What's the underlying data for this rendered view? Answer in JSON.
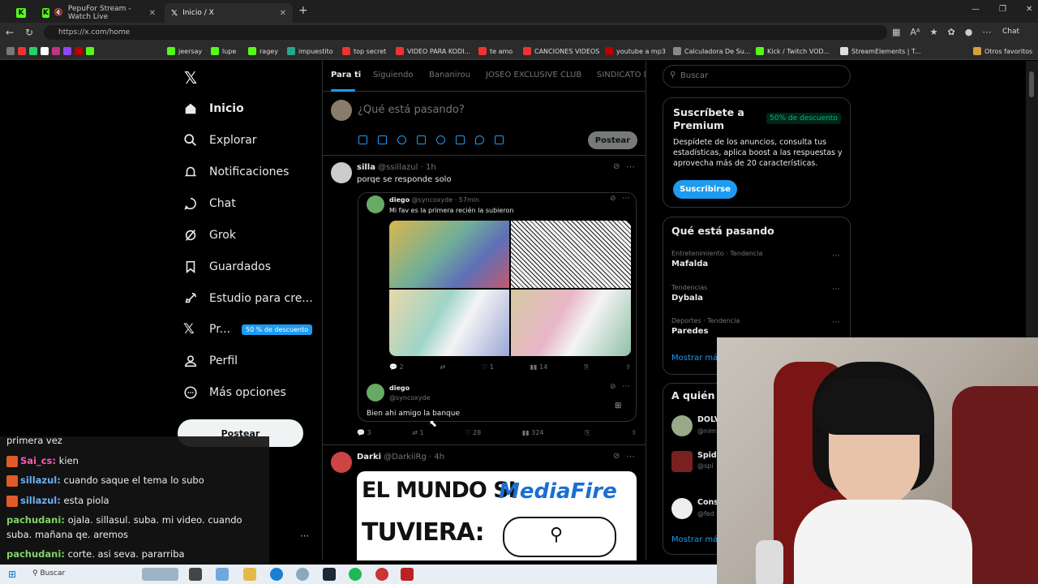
{
  "browser": {
    "tabs": [
      {
        "label": "",
        "icon": "kick-icon"
      },
      {
        "label": "PepuFor Stream - Watch Live",
        "icon": "kick-icon"
      },
      {
        "label": "Inicio / X",
        "icon": "x-icon"
      }
    ],
    "url": "https://x.com/home",
    "chat_label": "Chat",
    "bookmarks": [
      "jeersay",
      "lupe",
      "ragey",
      "impuestito",
      "top secret",
      "VIDEO PARA KODI...",
      "te amo",
      "CANCIONES VIDEOS",
      "youtube a mp3",
      "Calculadora De Su...",
      "Kick / Twitch VOD...",
      "StreamElements | T..."
    ],
    "other_favorites": "Otros favoritos"
  },
  "nav": {
    "items": [
      "Inicio",
      "Explorar",
      "Notificaciones",
      "Chat",
      "Grok",
      "Guardados",
      "Estudio para cre...",
      "Pr...",
      "Perfil",
      "Más opciones"
    ],
    "premium_badge": "50 % de descuento",
    "post_button": "Postear"
  },
  "feed": {
    "tabs": [
      "Para ti",
      "Siguiendo",
      "Bananirou",
      "JOSEO EXCLUSIVE CLUB",
      "SINDICATO D"
    ],
    "composer_placeholder": "¿Qué está pasando?",
    "composer_post": "Postear",
    "tweet1": {
      "name": "silla",
      "handle": "@ssillazul · 1h",
      "text": "porqe se responde solo",
      "quote": {
        "name": "diego",
        "handle": "@syncoxyde · 57min",
        "text": "Mi fav es la primera recién la subieron",
        "replies": "2",
        "likes": "1",
        "views": "14"
      },
      "reply": {
        "name": "diego",
        "handle": "@syncoxyde",
        "text": "Bien ahi amigo la banque"
      },
      "replies": "3",
      "retweets": "1",
      "likes": "28",
      "views": "324"
    },
    "tweet2": {
      "name": "Darki",
      "handle": "@DarkiiRg · 4h",
      "image_line1": "EL MUNDO SI",
      "image_brand": "MediaFire",
      "image_line2": "TUVIERA:"
    }
  },
  "right": {
    "search_placeholder": "Buscar",
    "premium": {
      "title": "Suscríbete a Premium",
      "badge": "50% de descuento",
      "text1": "Despídete de los anuncios, consulta tus",
      "text2": "estadísticas, aplica boost a las respuestas y",
      "text3": "aprovecha más de 20 características.",
      "button": "Suscribirse"
    },
    "trends": {
      "title": "Qué está pasando",
      "items": [
        {
          "meta": "Entretenimiento · Tendencia",
          "name": "Mafalda"
        },
        {
          "meta": "Tendencias",
          "name": "Dybala"
        },
        {
          "meta": "Deportes · Tendencia",
          "name": "Paredes"
        }
      ],
      "more": "Mostrar más"
    },
    "follow": {
      "title": "A quién s",
      "users": [
        {
          "name": "DOLV",
          "handle": "@nim"
        },
        {
          "name": "Spid",
          "handle": "@spi"
        },
        {
          "name": "Cons",
          "handle": "@fed"
        }
      ],
      "more": "Mostrar más"
    }
  },
  "chat": {
    "lines": [
      {
        "user": "",
        "text": "primera vez"
      },
      {
        "user": "Sai_cs:",
        "text": "kien"
      },
      {
        "user": "sillazul:",
        "text": "cuando saque el tema lo subo"
      },
      {
        "user": "sillazul:",
        "text": "esta piola"
      },
      {
        "user": "pachudani:",
        "text": "ojala. sillasul. suba. mi video. cuando"
      },
      {
        "user": "",
        "text": "suba. mañana qe. aremos"
      },
      {
        "user": "pachudani:",
        "text": "corte. asi seva. pararriba"
      }
    ]
  },
  "taskbar": {
    "search": "Buscar"
  },
  "colors": {
    "accent": "#1d9bf0",
    "kick": "#53fc18",
    "bg": "#000000",
    "premium_badge": "#00ba7c"
  }
}
